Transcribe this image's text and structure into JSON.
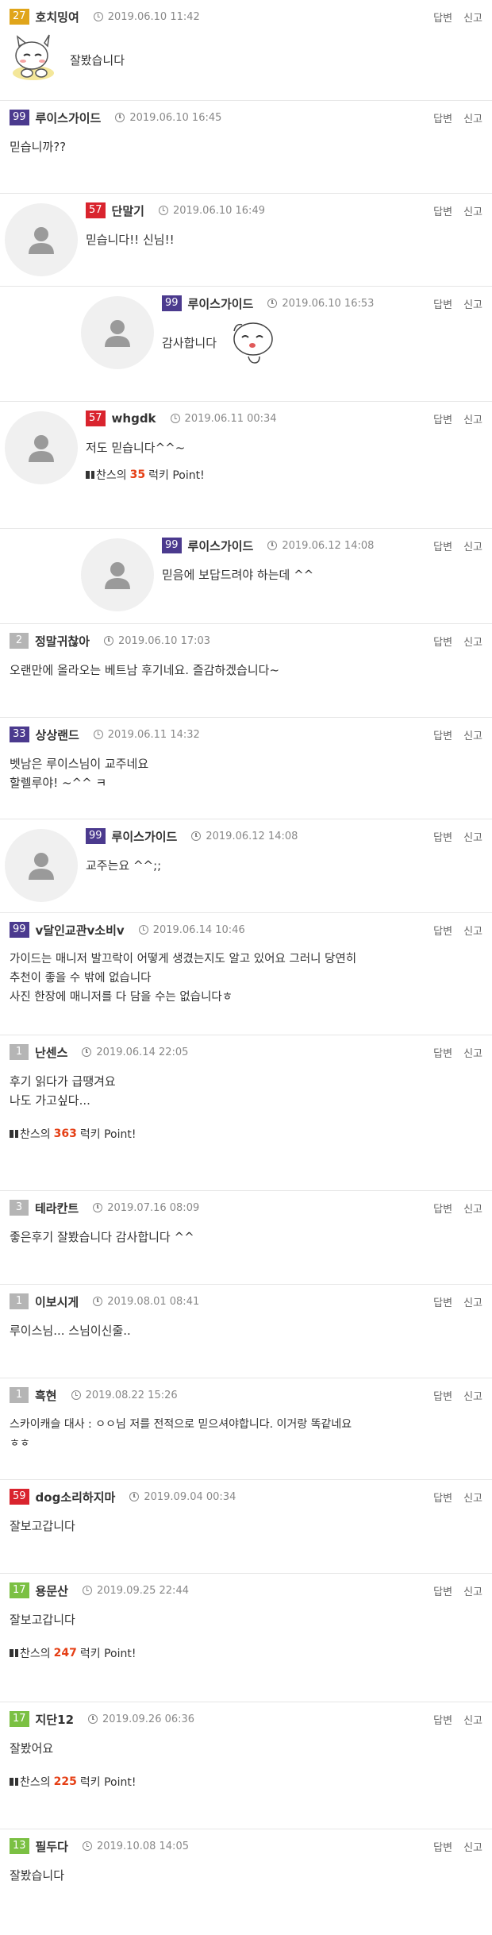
{
  "labels": {
    "reply": "답변",
    "report": "신고",
    "point_prefix": "찬스의",
    "point_suffix": "럭키 Point!"
  },
  "colors": {
    "accent_point": "#e53f15",
    "level_yellow": "#e0a51a",
    "level_purple": "#4b3a8e",
    "level_red": "#d9242e",
    "level_grey": "#b5b5b5",
    "level_green": "#7bc043"
  },
  "comments": [
    {
      "level": "27",
      "nick": "호치밍여",
      "time": "2019.06.10 11:42",
      "body": "잘봤습니다"
    },
    {
      "level": "99",
      "nick": "루이스가이드",
      "time": "2019.06.10 16:45",
      "body": "믿습니까??"
    },
    {
      "level": "57",
      "nick": "단말기",
      "time": "2019.06.10 16:49",
      "body": "믿습니다!! 신님!!"
    },
    {
      "level": "99",
      "nick": "루이스가이드",
      "time": "2019.06.10 16:53",
      "body": "감사합니다"
    },
    {
      "level": "57",
      "nick": "whgdk",
      "time": "2019.06.11 00:34",
      "body": "저도 믿습니다^^~",
      "point": "35"
    },
    {
      "level": "99",
      "nick": "루이스가이드",
      "time": "2019.06.12 14:08",
      "body": "믿음에 보답드려야 하는데 ^^"
    },
    {
      "level": "2",
      "nick": "정말귀찮아",
      "time": "2019.06.10 17:03",
      "body": "오랜만에 올라오는 베트남 후기네요. 즐감하겠습니다~"
    },
    {
      "level": "33",
      "nick": "상상랜드",
      "time": "2019.06.11 14:32",
      "body": "벳남은 루이스님이 교주네요\n할렐루야! ~^^ ㅋ"
    },
    {
      "level": "99",
      "nick": "루이스가이드",
      "time": "2019.06.12 14:08",
      "body": "교주는요 ^^;;"
    },
    {
      "level": "99",
      "nick": "v달인교관v소비v",
      "time": "2019.06.14 10:46",
      "body": "가이드는 매니저 발끄락이 어떻게 생겼는지도 알고 있어요 그러니 당연히\n추천이 좋을 수 밖에 없습니다\n사진 한장에 매니저를 다 담을 수는 없습니다ㅎ"
    },
    {
      "level": "1",
      "nick": "난센스",
      "time": "2019.06.14 22:05",
      "body": "후기   읽다가 급땡겨요\n나도 가고싶다...",
      "point": "363"
    },
    {
      "level": "3",
      "nick": "테라칸트",
      "time": "2019.07.16 08:09",
      "body": "좋은후기 잘봤습니다 감사합니다 ^^"
    },
    {
      "level": "1",
      "nick": "이보시게",
      "time": "2019.08.01 08:41",
      "body": "루이스님... 스님이신줄.."
    },
    {
      "level": "1",
      "nick": "흑현",
      "time": "2019.08.22 15:26",
      "body": "스카이캐슬 대사 : ㅇㅇ님 저를 전적으로 믿으셔야합니다. 이거랑 똑같네요\nㅎㅎ"
    },
    {
      "level": "59",
      "nick": "dog소리하지마",
      "time": "2019.09.04 00:34",
      "body": "잘보고갑니다"
    },
    {
      "level": "17",
      "nick": "용문산",
      "time": "2019.09.25 22:44",
      "body": "잘보고갑니다",
      "point": "247"
    },
    {
      "level": "17",
      "nick": "지단12",
      "time": "2019.09.26 06:36",
      "body": "잘봤어요",
      "point": "225"
    },
    {
      "level": "13",
      "nick": "필두다",
      "time": "2019.10.08 14:05",
      "body": "잘봤습니다"
    }
  ]
}
